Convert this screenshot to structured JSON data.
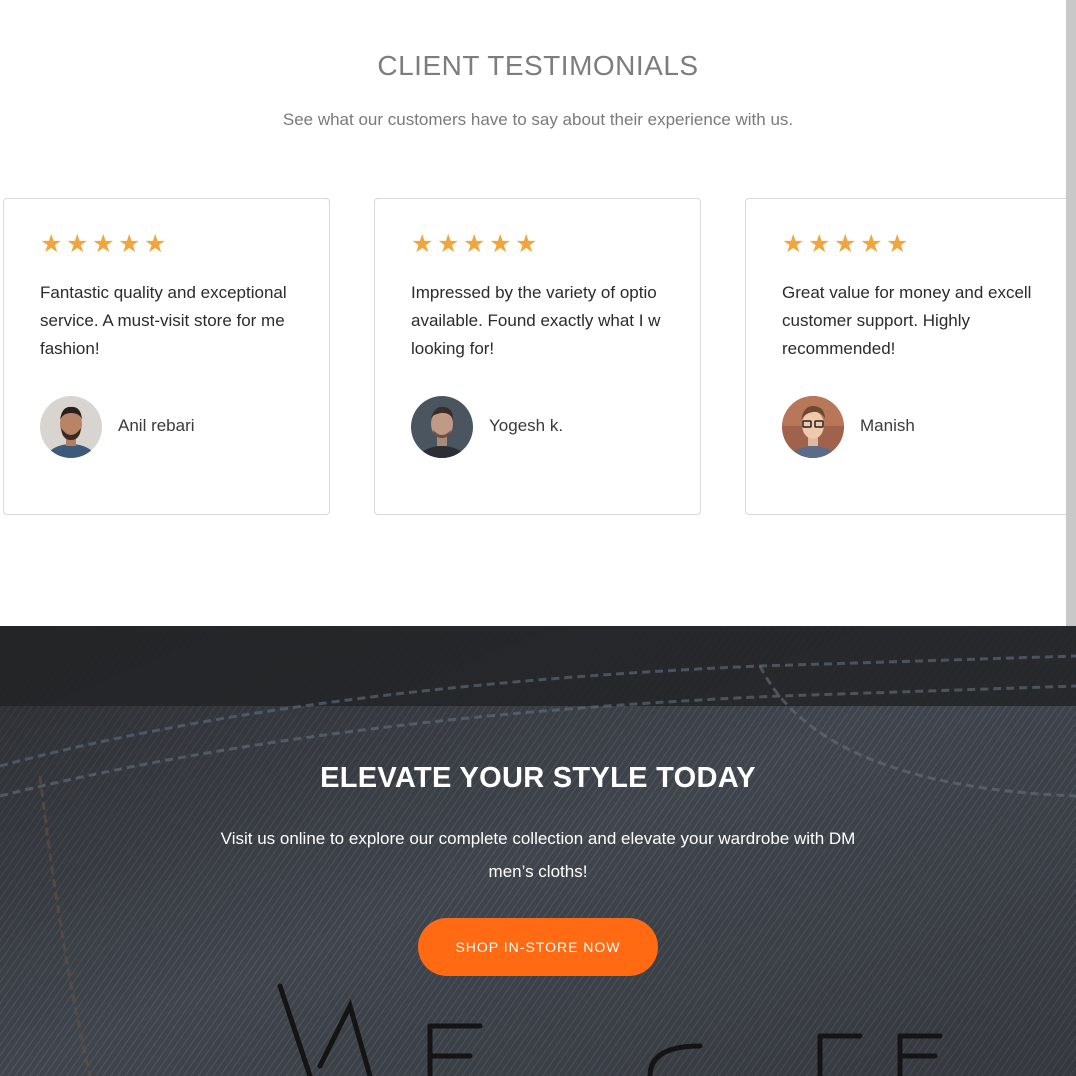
{
  "testimonials": {
    "title": "CLIENT TESTIMONIALS",
    "subtitle": "See what our customers have to say about their experience with us.",
    "star_color": "#f0a63c",
    "cards": [
      {
        "rating": 5,
        "quote": "Fantastic quality and exceptional service. A must-visit store for me fashion!",
        "author": "Anil rebari",
        "avatar": "avatar-photo-1"
      },
      {
        "rating": 5,
        "quote": "Impressed by the variety of optio available. Found exactly what I w looking for!",
        "author": "Yogesh k.",
        "avatar": "avatar-photo-2"
      },
      {
        "rating": 5,
        "quote": "Great value for money and excell customer support. Highly recommended!",
        "author": "Manish",
        "avatar": "avatar-photo-3"
      }
    ],
    "stars": [
      "★",
      "★",
      "★",
      "★",
      "★"
    ]
  },
  "cta": {
    "title": "ELEVATE YOUR STYLE TODAY",
    "text": "Visit us online to explore our complete collection and elevate your wardrobe with DM men’s cloths!",
    "button_label": "SHOP IN-STORE NOW",
    "button_color": "#ff6a13"
  }
}
